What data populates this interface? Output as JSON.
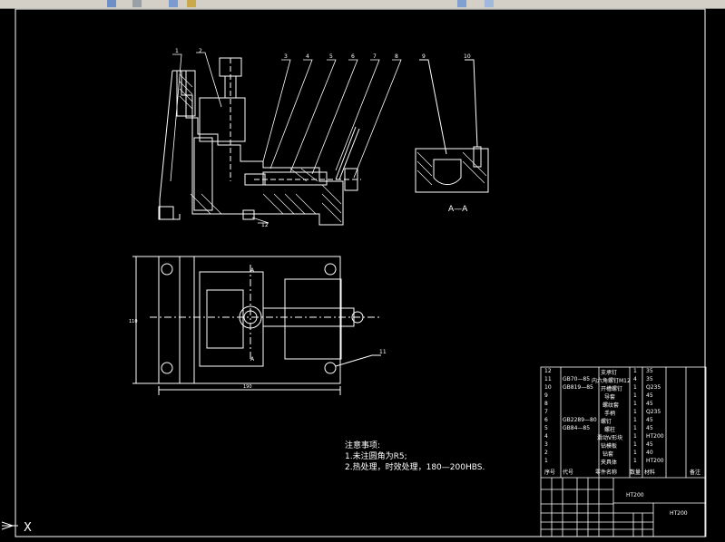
{
  "toolbar": {
    "icons": [
      "open-icon",
      "save-icon",
      "layer-icon",
      "color-icon",
      "linetype-icon",
      "zoom-icon"
    ]
  },
  "drawing": {
    "section_label": "A—A",
    "view_marker": "A",
    "balloon_numbers": [
      "1",
      "2",
      "3",
      "4",
      "5",
      "6",
      "7",
      "8",
      "9",
      "10",
      "11",
      "12"
    ],
    "dims": {
      "width": "190",
      "height": "110"
    }
  },
  "notes": {
    "title": "注意事项:",
    "line1": "1.未注圆角为R5;",
    "line2": "2.热处理，时效处理，180—200HBS."
  },
  "bom": {
    "rows": [
      {
        "no": "12",
        "code": "",
        "name": "支承钉",
        "qty": "1",
        "mat": "35"
      },
      {
        "no": "11",
        "code": "GB70—85",
        "name": "内六角螺钉M12",
        "qty": "4",
        "mat": "35"
      },
      {
        "no": "10",
        "code": "GB819—85",
        "name": "开槽螺钉",
        "qty": "1",
        "mat": "Q235"
      },
      {
        "no": "9",
        "code": "",
        "name": "导套",
        "qty": "1",
        "mat": "45"
      },
      {
        "no": "8",
        "code": "",
        "name": "螺纹套",
        "qty": "1",
        "mat": "45"
      },
      {
        "no": "7",
        "code": "",
        "name": "手柄",
        "qty": "1",
        "mat": "Q235"
      },
      {
        "no": "6",
        "code": "GB2289—80",
        "name": "螺钉",
        "qty": "1",
        "mat": "45"
      },
      {
        "no": "5",
        "code": "GB84—85",
        "name": "螺柱",
        "qty": "1",
        "mat": "45"
      },
      {
        "no": "4",
        "code": "",
        "name": "滑动V形块",
        "qty": "1",
        "mat": "HT200"
      },
      {
        "no": "3",
        "code": "",
        "name": "钻模板",
        "qty": "1",
        "mat": "45"
      },
      {
        "no": "2",
        "code": "",
        "name": "钻套",
        "qty": "1",
        "mat": "40"
      },
      {
        "no": "1",
        "code": "",
        "name": "夹具体",
        "qty": "1",
        "mat": "HT200"
      }
    ],
    "header": {
      "no": "序号",
      "code": "代号",
      "name": "零件名称",
      "qty": "数量",
      "mat": "材料",
      "note": "备注"
    }
  },
  "title_block": {
    "material_center": "HT200",
    "material_right": "HT200"
  },
  "ucs": {
    "label": "X"
  },
  "colors": {
    "background": "#000000",
    "lines": "#ffffff",
    "toolbar": "#d4d0c8"
  }
}
